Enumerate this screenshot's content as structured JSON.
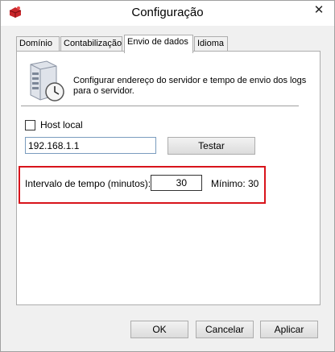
{
  "window": {
    "title": "Configuração",
    "close_glyph": "✕"
  },
  "tabs": [
    {
      "label": "Domínio",
      "active": false
    },
    {
      "label": "Contabilização",
      "active": false
    },
    {
      "label": "Envio de dados",
      "active": true
    },
    {
      "label": "Idioma",
      "active": false
    }
  ],
  "panel": {
    "icon": "server-clock-icon",
    "description": "Configurar endereço do servidor e tempo de envio dos logs para o servidor.",
    "host_local": {
      "label": "Host local",
      "checked": false
    },
    "server_address": {
      "value": "192.168.1.1"
    },
    "test_button": "Testar",
    "interval": {
      "label": "Intervalo de tempo (minutos):",
      "value": "30",
      "minimum": "Mínimo: 30"
    }
  },
  "footer": {
    "ok": "OK",
    "cancel": "Cancelar",
    "apply": "Aplicar"
  },
  "colors": {
    "highlight": "#d8141b",
    "window_bg": "#f0f0f0"
  }
}
